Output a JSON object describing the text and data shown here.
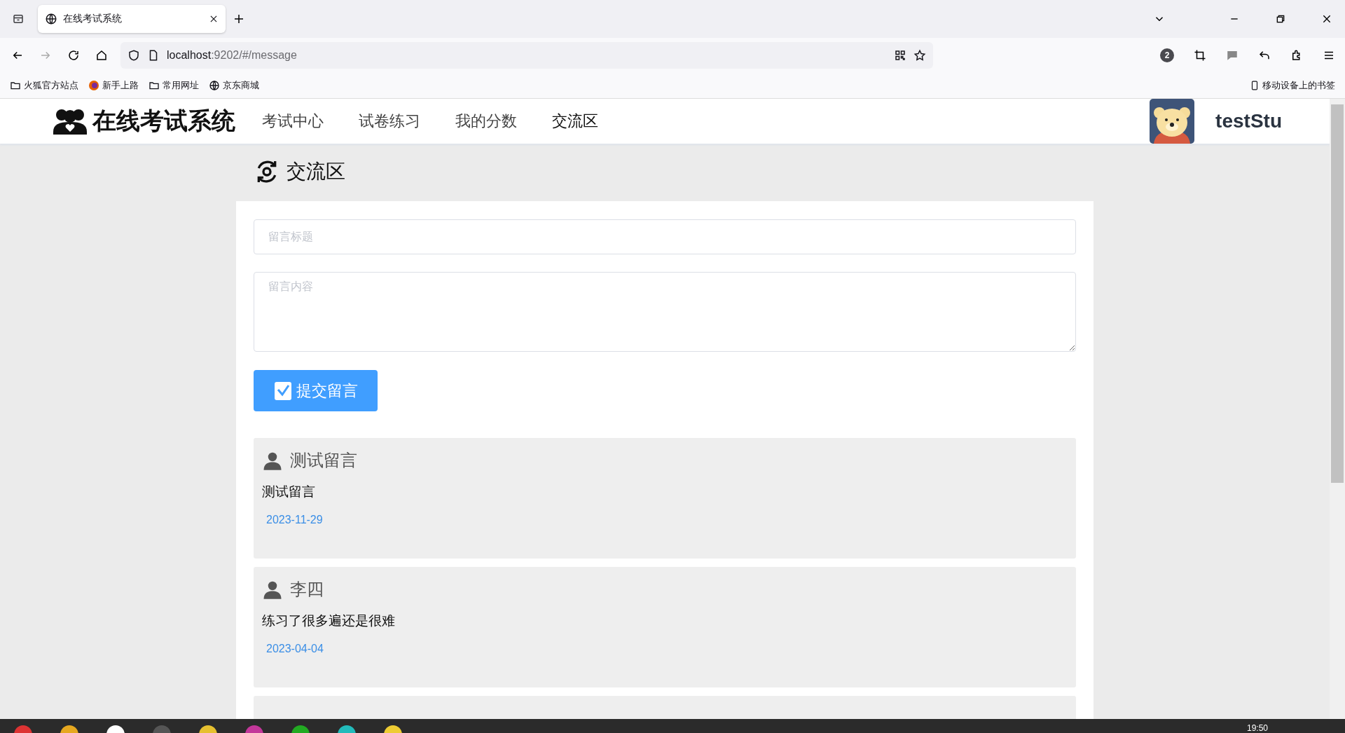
{
  "browser": {
    "tabs": [
      {
        "title": "在线考试系统",
        "selected": true
      }
    ],
    "url_host": "localhost",
    "url_path": ":9202/#/message",
    "notification_count": "2",
    "bookmarks": [
      {
        "kind": "folder",
        "label": "火狐官方站点"
      },
      {
        "kind": "firefox",
        "label": "新手上路"
      },
      {
        "kind": "folder",
        "label": "常用网址"
      },
      {
        "kind": "globe",
        "label": "京东商城"
      }
    ],
    "mobile_bookmarks": "移动设备上的书签"
  },
  "header": {
    "logo": "在线考试系统",
    "nav": [
      {
        "label": "考试中心",
        "selected": false
      },
      {
        "label": "试卷练习",
        "selected": false
      },
      {
        "label": "我的分数",
        "selected": false
      },
      {
        "label": "交流区",
        "selected": true
      }
    ],
    "username": "testStu"
  },
  "page_title": "交流区",
  "form": {
    "title_placeholder": "留言标题",
    "content_placeholder": "留言内容",
    "submit": "提交留言"
  },
  "messages": [
    {
      "author": "测试留言",
      "content": "测试留言",
      "date": "2023-11-29"
    },
    {
      "author": "李四",
      "content": "练习了很多遍还是很难",
      "date": "2023-04-04"
    }
  ],
  "taskbar": {
    "clock": "19:50"
  }
}
